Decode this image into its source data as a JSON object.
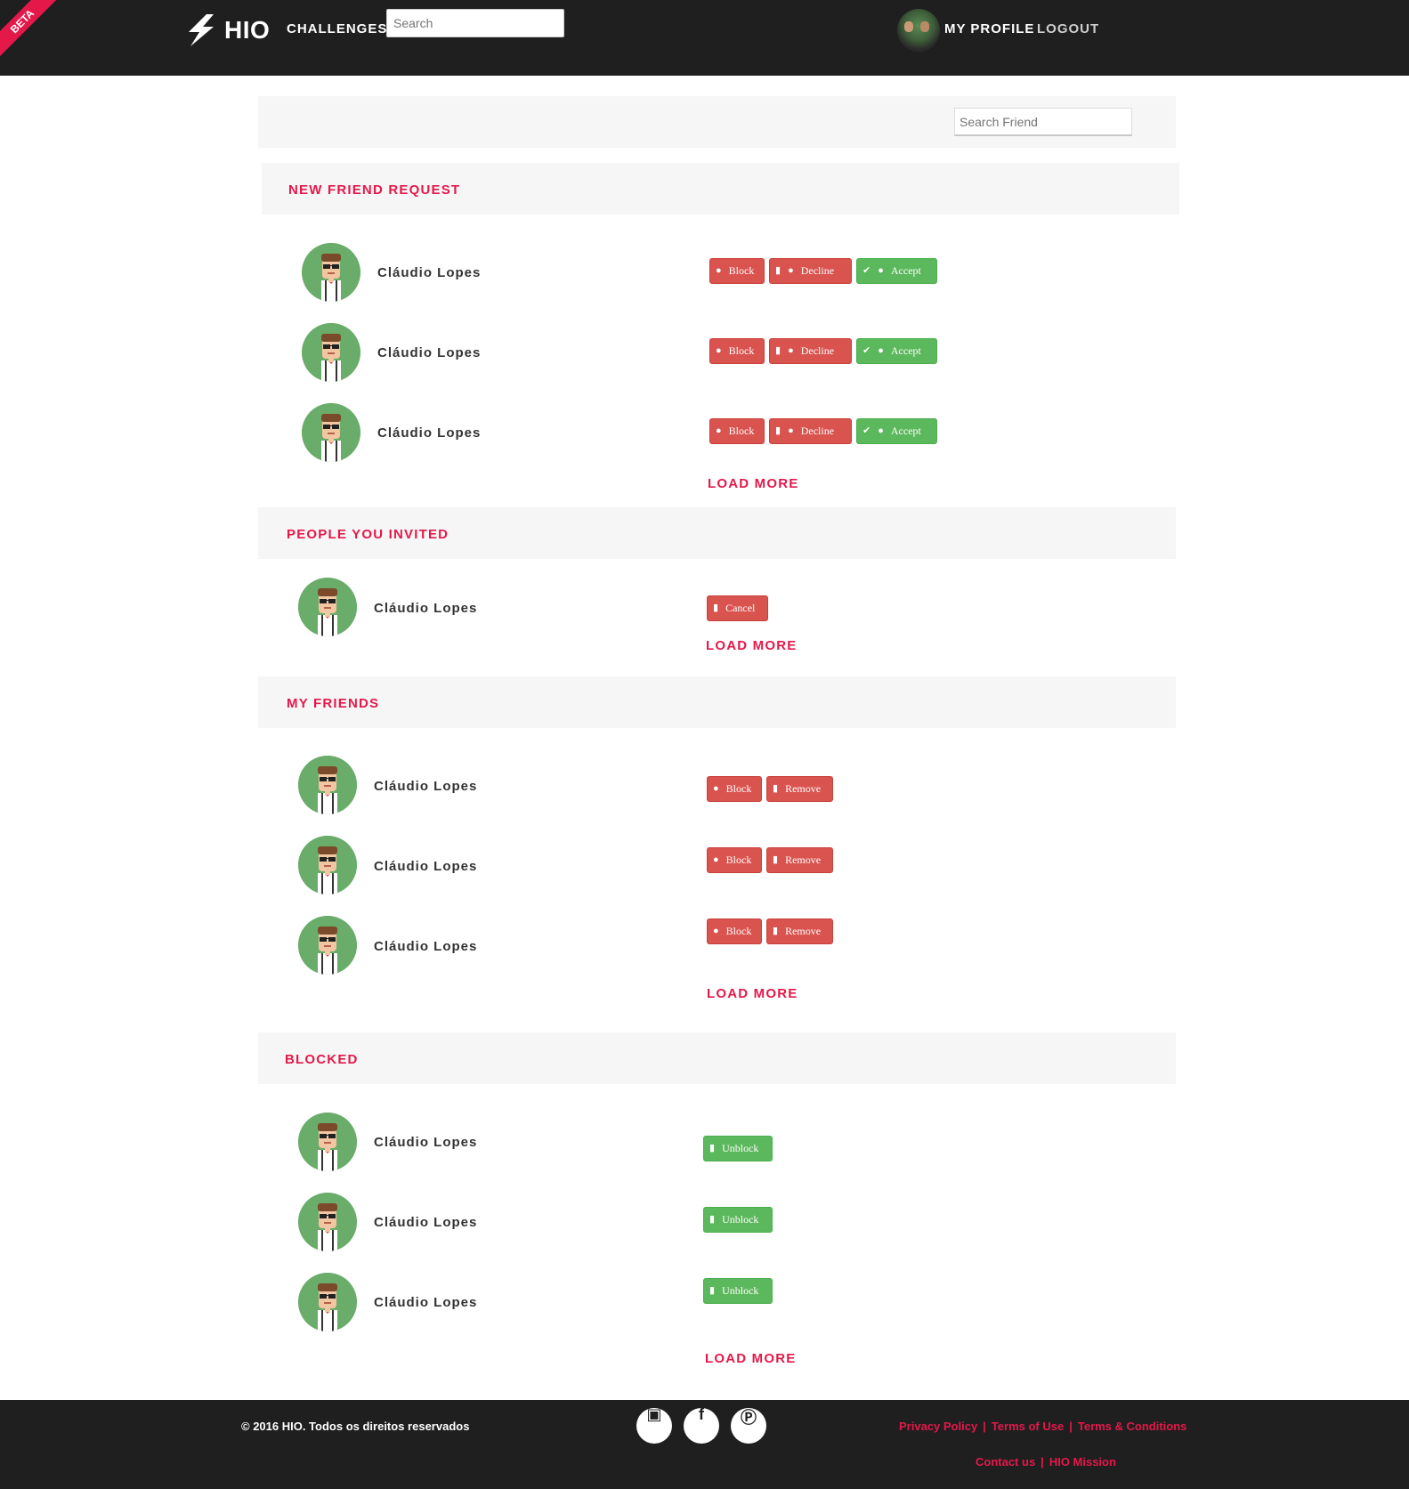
{
  "header": {
    "beta": "BETA",
    "logo": "HIO",
    "nav_challenges": "CHALLENGES",
    "search_placeholder": "Search",
    "my_profile": "MY PROFILE",
    "logout": "LOGOUT"
  },
  "filter": {
    "search_friend_placeholder": "Search Friend"
  },
  "sections": {
    "requests": {
      "title": "NEW FRIEND REQUEST",
      "people": [
        "Cláudio Lopes",
        "Cláudio Lopes",
        "Cláudio Lopes"
      ],
      "block_label": "Block",
      "decline_label": "Decline",
      "accept_label": "Accept",
      "load_more": "LOAD MORE"
    },
    "invited": {
      "title": "PEOPLE YOU INVITED",
      "people": [
        "Cláudio Lopes"
      ],
      "cancel_label": "Cancel",
      "load_more": "LOAD MORE"
    },
    "friends": {
      "title": "MY FRIENDS",
      "people": [
        "Cláudio Lopes",
        "Cláudio Lopes",
        "Cláudio Lopes"
      ],
      "block_label": "Block",
      "remove_label": "Remove",
      "load_more": "LOAD MORE"
    },
    "blocked": {
      "title": "BLOCKED",
      "people": [
        "Cláudio Lopes",
        "Cláudio Lopes",
        "Cláudio Lopes"
      ],
      "unblock_label": "Unblock",
      "load_more": "LOAD MORE"
    }
  },
  "footer": {
    "copyright": "© 2016 HIO. Todos os direitos reservados",
    "social": [
      "instagram-icon",
      "facebook-icon",
      "wordpress-icon"
    ],
    "links_row1": [
      "Privacy Policy",
      "Terms of Use",
      "Terms & Conditions"
    ],
    "links_row2": [
      "Contact us",
      "HIO Mission"
    ]
  },
  "colors": {
    "brand_red": "#e5184a",
    "button_red": "#d9534f",
    "button_green": "#5cb85c",
    "nav_bg": "#1f1f20",
    "section_bg": "#f6f6f6"
  }
}
